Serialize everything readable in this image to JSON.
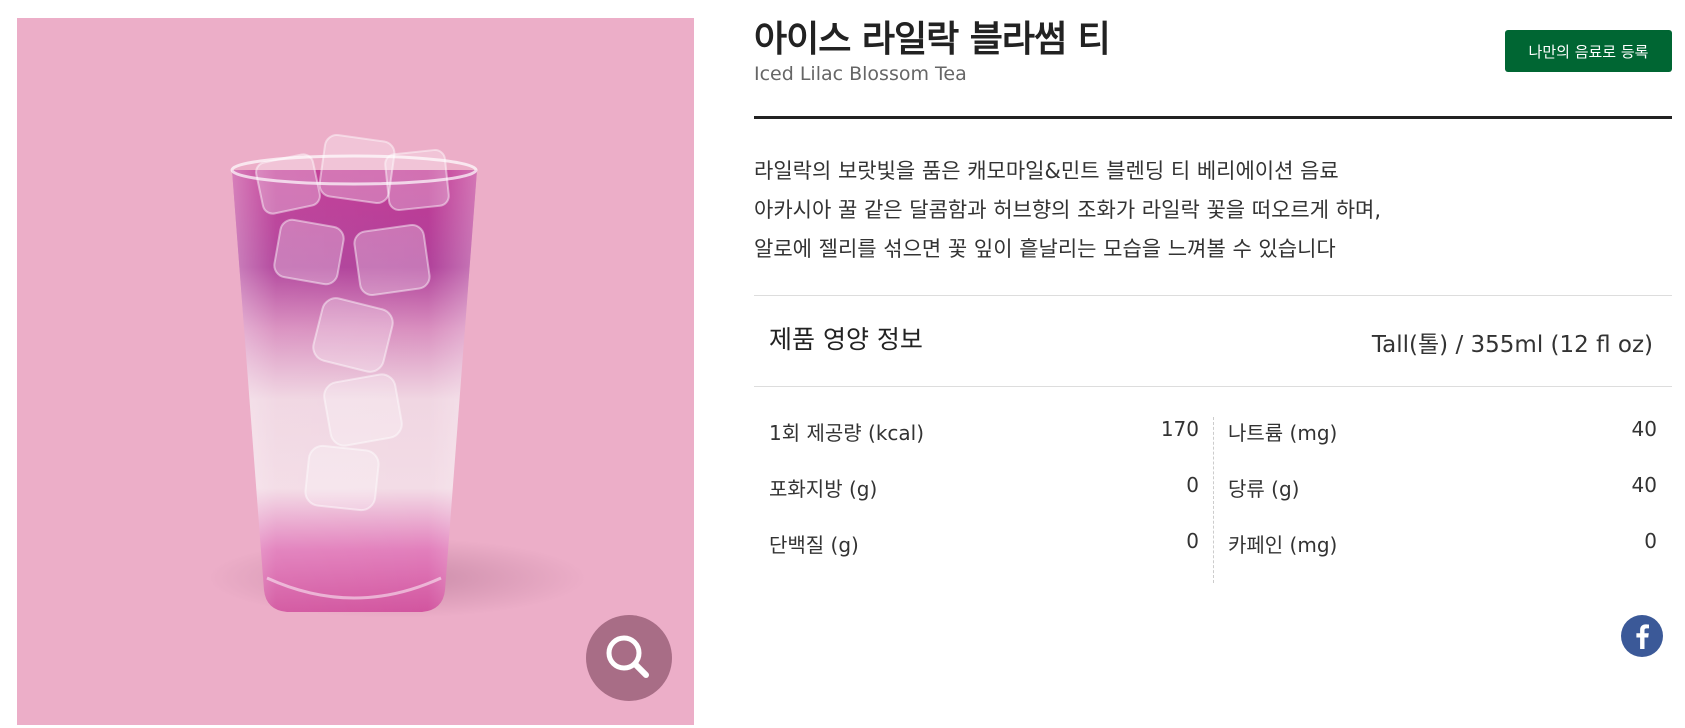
{
  "product": {
    "name_ko": "아이스 라일락 블라썸 티",
    "name_en": "Iced Lilac Blossom Tea",
    "register_label": "나만의 음료로 등록",
    "description_lines": [
      "라일락의 보랏빛을 품은 캐모마일&민트 블렌딩 티 베리에이션 음료",
      "아카시아 꿀 같은 달콤함과 허브향의 조화가 라일락 꽃을 떠오르게 하며,",
      "알로에 젤리를 섞으면 꽃 잎이 흩날리는 모습을 느껴볼 수 있습니다"
    ]
  },
  "image": {
    "background_color": "#ecaec8",
    "zoom_icon": "magnifier-icon"
  },
  "nutrition": {
    "title": "제품 영양 정보",
    "size": "Tall(톨) / 355ml (12 fl oz)",
    "left": [
      {
        "label": "1회 제공량 (kcal)",
        "value": "170"
      },
      {
        "label": "포화지방 (g)",
        "value": "0"
      },
      {
        "label": "단백질 (g)",
        "value": "0"
      }
    ],
    "right": [
      {
        "label": "나트륨 (mg)",
        "value": "40"
      },
      {
        "label": "당류 (g)",
        "value": "40"
      },
      {
        "label": "카페인 (mg)",
        "value": "0"
      }
    ]
  },
  "share": {
    "icon": "facebook-icon"
  },
  "colors": {
    "brand_green": "#006633",
    "facebook_blue": "#3b5998",
    "zoom_button": "#a86d86"
  }
}
